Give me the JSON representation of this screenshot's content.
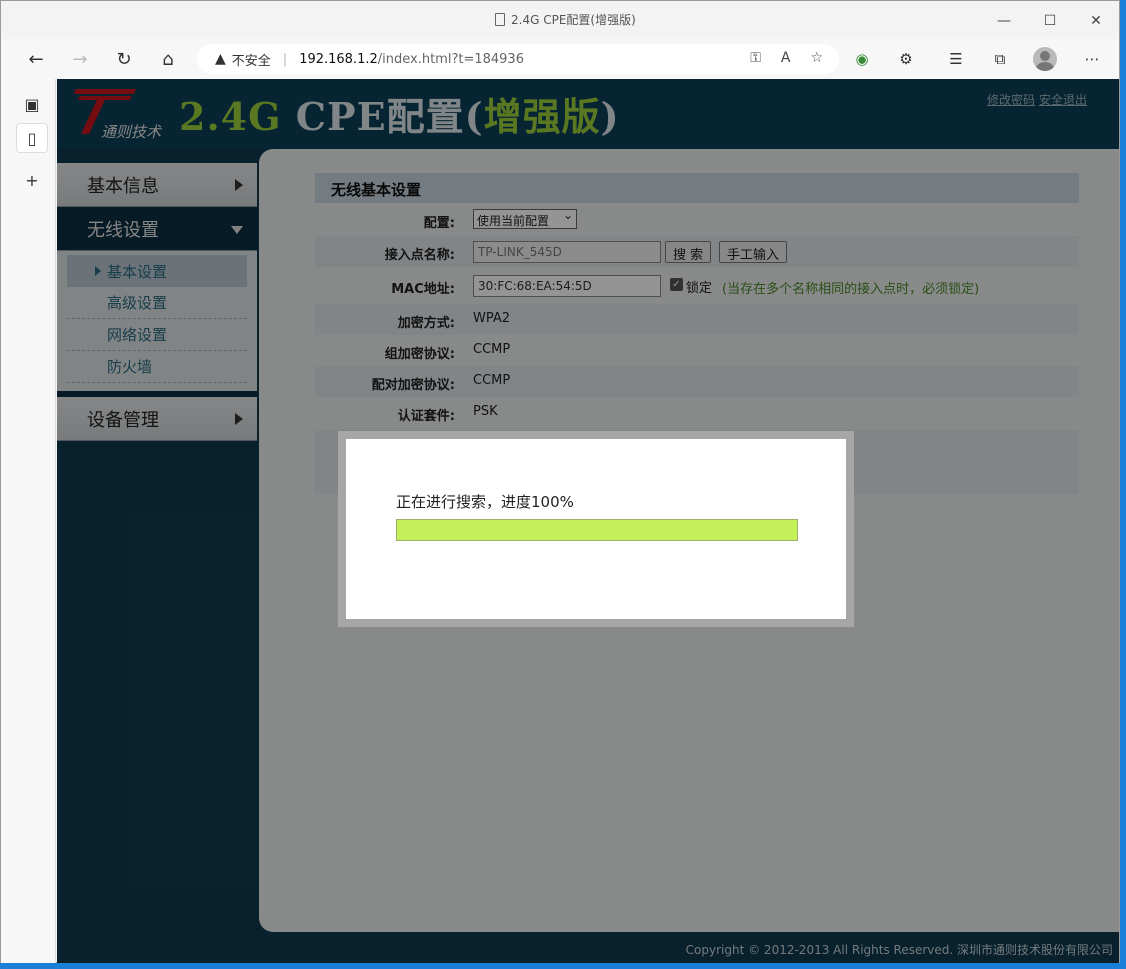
{
  "browser": {
    "tab_title": "2.4G CPE配置(增强版)",
    "address": {
      "warning": "不安全",
      "host": "192.168.1.2",
      "path": "/index.html?t=184936"
    }
  },
  "header": {
    "logo_text": "通则技术",
    "title_green": "2.4G",
    "title_white": "CPE配置(",
    "title_green2": "增强版",
    "title_close": ")",
    "link_password": "修改密码",
    "link_logout": "安全退出"
  },
  "sidebar": {
    "groups": [
      {
        "label": "基本信息",
        "expanded": false
      },
      {
        "label": "无线设置",
        "expanded": true
      },
      {
        "label": "设备管理",
        "expanded": false
      }
    ],
    "subitems": [
      {
        "label": "基本设置",
        "selected": true
      },
      {
        "label": "高级设置",
        "selected": false
      },
      {
        "label": "网络设置",
        "selected": false
      },
      {
        "label": "防火墙",
        "selected": false
      }
    ]
  },
  "main": {
    "section_title": "无线基本设置",
    "config": {
      "label": "配置:",
      "selected": "使用当前配置"
    },
    "ap_name": {
      "label": "接入点名称:",
      "value": "TP-LINK_545D",
      "search_btn": "搜 索",
      "manual_btn": "手工输入"
    },
    "mac": {
      "label": "MAC地址:",
      "value": "30:FC:68:EA:54:5D",
      "lock_label": "锁定",
      "lock_checked": true,
      "note": "(当存在多个名称相同的接入点时，必须锁定)"
    },
    "encryption": {
      "label": "加密方式:",
      "value": "WPA2"
    },
    "group_cipher": {
      "label": "组加密协议:",
      "value": "CCMP"
    },
    "pair_cipher": {
      "label": "配对加密协议:",
      "value": "CCMP"
    },
    "auth_suite": {
      "label": "认证套件:",
      "value": "PSK"
    }
  },
  "modal": {
    "message": "正在进行搜索，进度100%",
    "progress": 1.0
  },
  "footer": {
    "copyright": "Copyright © 2012-2013 All Rights Reserved. 深圳市通则技术股份有限公司"
  },
  "colors": {
    "header_bg": "#0c3f55",
    "title_green": "#9bcd3c",
    "progress_fill": "#c4f05a",
    "logo_red": "#c8161d"
  }
}
